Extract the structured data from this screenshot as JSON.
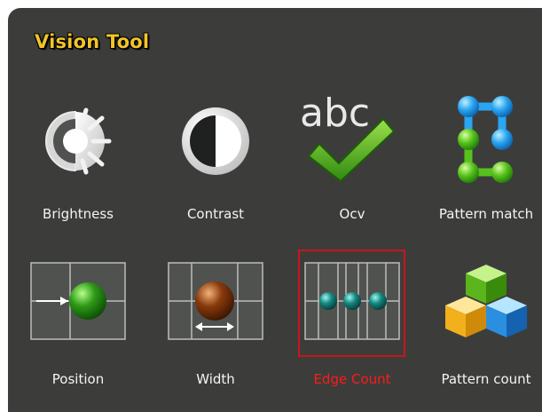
{
  "title": "Vision Tool",
  "tools": [
    {
      "label": "Brightness",
      "icon": "brightness-icon",
      "selected": false
    },
    {
      "label": "Contrast",
      "icon": "contrast-icon",
      "selected": false
    },
    {
      "label": "Ocv",
      "icon": "ocv-abc-check-icon",
      "selected": false
    },
    {
      "label": "Pattern match",
      "icon": "pattern-match-icon",
      "selected": false
    },
    {
      "label": "Position",
      "icon": "position-icon",
      "selected": false
    },
    {
      "label": "Width",
      "icon": "width-icon",
      "selected": false
    },
    {
      "label": "Edge Count",
      "icon": "edge-count-icon",
      "selected": true
    },
    {
      "label": "Pattern count",
      "icon": "pattern-count-icon",
      "selected": false
    }
  ],
  "colors": {
    "panel_bg": "#3c3d3b",
    "title": "#f2c42a",
    "label": "#f4f4f4",
    "selected_label": "#ff1a1a",
    "selected_border": "#c8161b"
  },
  "ocv_icon_text": "abc"
}
